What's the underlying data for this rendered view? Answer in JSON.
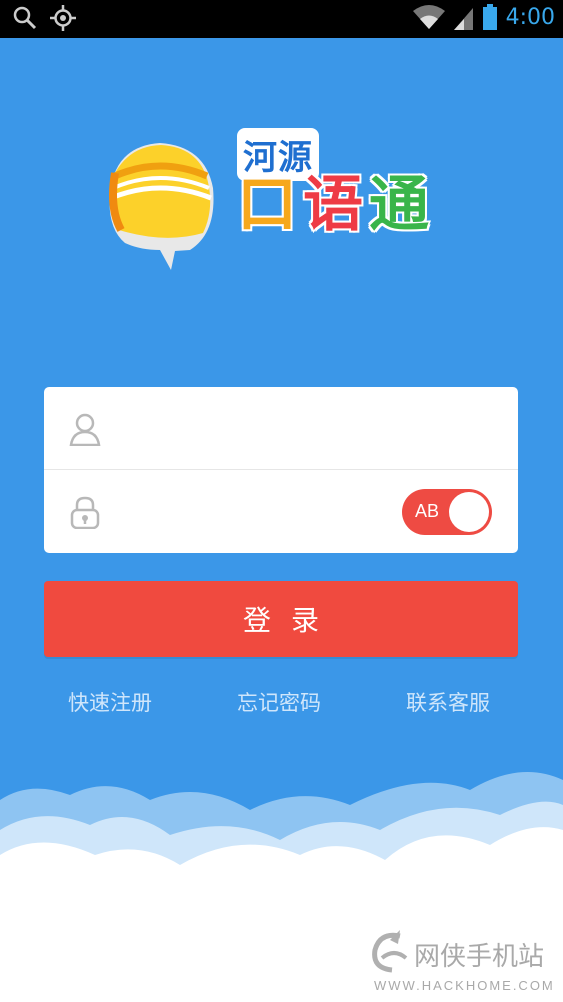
{
  "status_bar": {
    "time": "4:00",
    "icons": [
      "search-icon",
      "location-icon",
      "wifi-icon",
      "signal-icon",
      "battery-icon"
    ]
  },
  "logo": {
    "small_text": "河源",
    "big_text": [
      "口",
      "语",
      "通"
    ]
  },
  "login_form": {
    "username_placeholder": "",
    "password_placeholder": "",
    "toggle_label": "AB",
    "submit_label": "登录"
  },
  "links": {
    "register": "快速注册",
    "forgot_password": "忘记密码",
    "contact_support": "联系客服"
  },
  "watermark": {
    "cn": "网侠手机站",
    "en": "WWW.HACKHOME.COM"
  },
  "colors": {
    "background": "#3b97e8",
    "accent_red": "#f04a3f",
    "status_time": "#39a8ec"
  }
}
